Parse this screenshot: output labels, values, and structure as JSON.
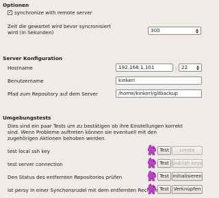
{
  "optionen": {
    "heading": "Optionen",
    "sync_label": "synchronize with remote server",
    "sync_checked": true,
    "wait_label_line1": "Zeit die gewartet wird bevor syncronisiert",
    "wait_label_line2": "wird (in Sekunden)",
    "wait_value": "300"
  },
  "server": {
    "heading": "Server Konfiguration",
    "hostname_label": "Hostname",
    "hostname_value": "192.168.1.101",
    "port_separator": ":",
    "port_value": "22",
    "username_label": "Benutzername",
    "username_value": "kinkerl",
    "repo_label": "Pfad zum Repository auf dem Server",
    "repo_value": "/home/kinkerl/gitbackup"
  },
  "tests": {
    "heading": "Umgebungstests",
    "description_line1": "Dies sind ein paar Tests um zu bestätigen ob ihre Einstellungen korrekt",
    "description_line2": "sind. Wenn Probleme auftreten können sie eventuell mit den",
    "description_line3": "zugehörigen Aktionen behoben werden.",
    "rows": [
      {
        "label": "test local ssh key",
        "test_label": "Test",
        "action_label": "create",
        "action_enabled": false
      },
      {
        "label": "test server connection",
        "test_label": "Test",
        "action_label": "publish keys",
        "action_enabled": false
      },
      {
        "label": "Den Status des entfernten Repositories prüfen",
        "test_label": "Test",
        "action_label": "initialisieren",
        "action_enabled": true
      },
      {
        "label": "ist persy in einer Synchonsrudel mit dem entfernten Rechner",
        "test_label": "Test",
        "action_label": "Verknüpfen",
        "action_enabled": true
      }
    ]
  },
  "icons": {
    "status": "pink-pony-icon"
  },
  "colors": {
    "background": "#efebe7",
    "icon_pink": "#c040c8"
  }
}
